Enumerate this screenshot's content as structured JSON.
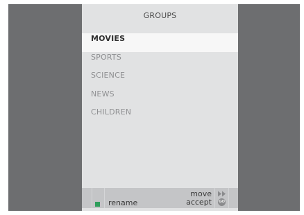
{
  "panel": {
    "title": "GROUPS"
  },
  "groups": [
    {
      "label": "MOVIES",
      "selected": true
    },
    {
      "label": "SPORTS",
      "selected": false
    },
    {
      "label": "SCIENCE",
      "selected": false
    },
    {
      "label": "NEWS",
      "selected": false
    },
    {
      "label": "CHILDREN",
      "selected": false
    }
  ],
  "footer": {
    "green_key_color": "#2f9e5c",
    "green_key_icon": "green-square-key-icon",
    "rename_label": "rename",
    "move_label": "move",
    "move_icon": "fast-forward-icon",
    "accept_label": "accept",
    "accept_icon": "go-button-icon",
    "accept_icon_text": "GO"
  },
  "colors": {
    "background": "#6d6e70",
    "panel": "#e1e2e3",
    "selected_row": "#f7f7f7",
    "footer": "#c4c5c7"
  }
}
